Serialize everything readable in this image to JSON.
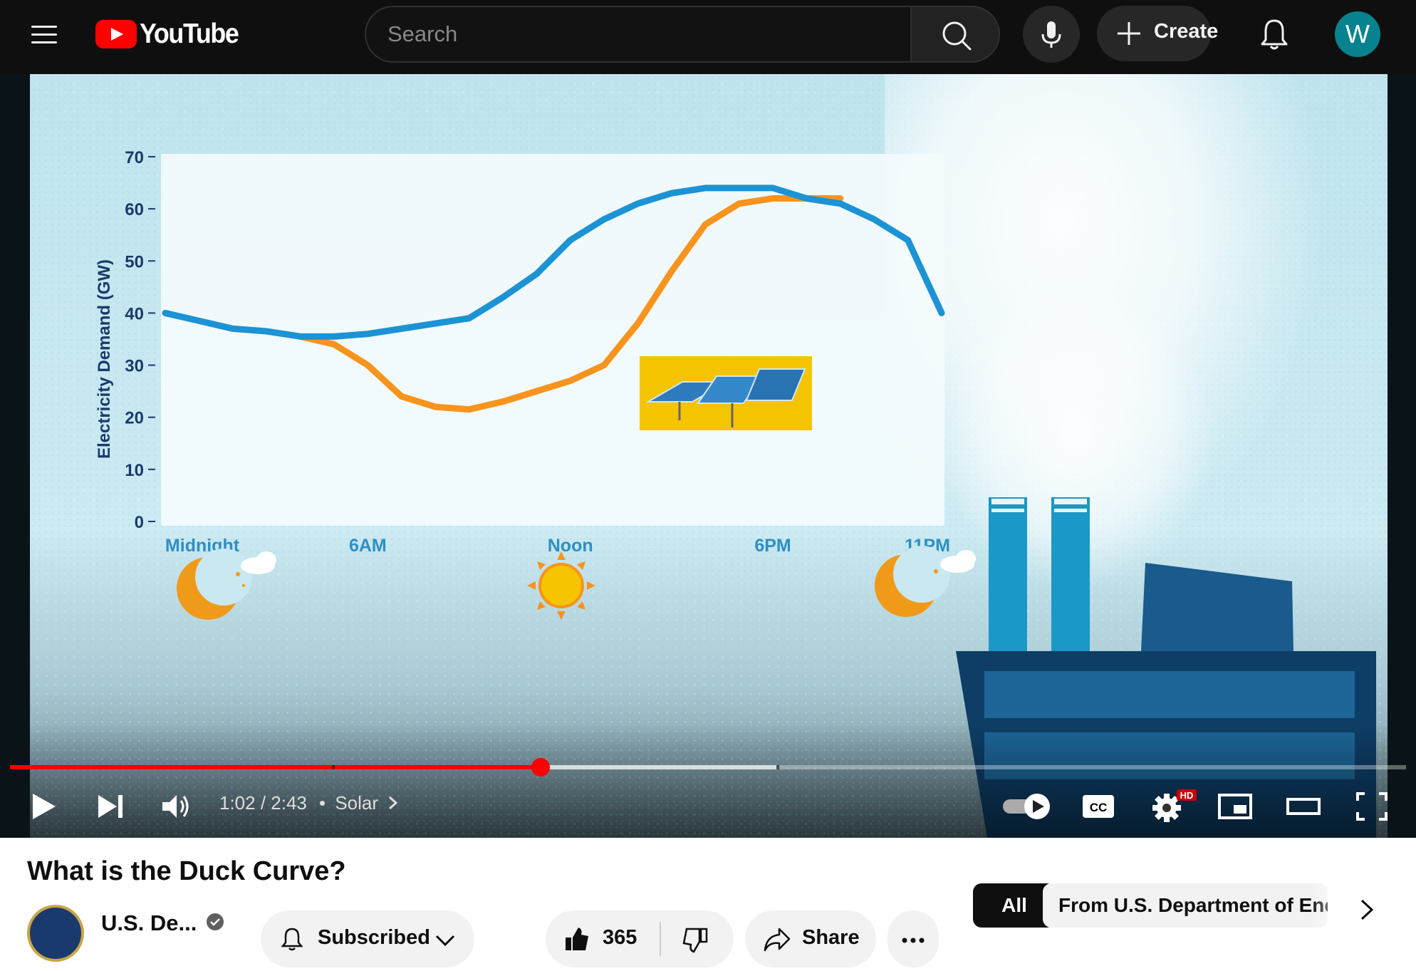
{
  "masthead": {
    "logo_text": "YouTube",
    "search_placeholder": "Search",
    "create_label": "Create",
    "avatar_initial": "W"
  },
  "player": {
    "time_current": "1:02",
    "time_separator": " / ",
    "time_total": "2:43",
    "chapter_separator": "•",
    "chapter_label": "Solar",
    "progress_played_fraction": 0.38,
    "progress_buffered_fraction": 0.55,
    "hd_badge": "HD",
    "cc_label": "CC"
  },
  "video_frame": {
    "chart_data": {
      "type": "line",
      "ylabel": "Electricity Demand (GW)",
      "yticks": [
        0,
        10,
        20,
        30,
        40,
        50,
        60,
        70
      ],
      "ylim": [
        0,
        70
      ],
      "x_tick_labels": [
        "Midnight",
        "6AM",
        "Noon",
        "6PM",
        "11PM"
      ],
      "x_tick_hours": [
        0,
        6,
        12,
        18,
        23
      ],
      "xlim": [
        0,
        23
      ],
      "series": [
        {
          "color": "#1b93d4",
          "x": [
            0,
            1,
            2,
            3,
            4,
            5,
            6,
            7,
            8,
            9,
            10,
            11,
            12,
            13,
            14,
            15,
            16,
            17,
            18,
            19,
            20,
            21,
            22,
            23
          ],
          "values": [
            40,
            38.5,
            37,
            36.5,
            35.5,
            35.5,
            36,
            37,
            38,
            39,
            43,
            47.5,
            54,
            58,
            61,
            63,
            64,
            64,
            64,
            62,
            61,
            58,
            54,
            40
          ]
        },
        {
          "color": "#f7941d",
          "x": [
            4,
            5,
            6,
            7,
            8,
            9,
            10,
            11,
            12,
            13,
            14,
            15,
            16,
            17,
            18,
            19,
            20
          ],
          "values": [
            35.5,
            34,
            30,
            24,
            22,
            21.5,
            23,
            25,
            27,
            30,
            38,
            48,
            57,
            61,
            62,
            62,
            62
          ]
        }
      ]
    },
    "icons": [
      "moon-icon",
      "cloud-icon",
      "sun-icon",
      "solar-panel-icon",
      "factory-icon"
    ]
  },
  "below": {
    "title": "What is the Duck Curve?",
    "channel_name": "U.S. De...",
    "subscribe_label": "Subscribed",
    "like_count": "365",
    "share_label": "Share",
    "chip_all": "All",
    "chip_from": "From U.S. Department of Ener"
  },
  "colors": {
    "brand_red": "#ff0000",
    "masthead_bg": "#0f0f0f",
    "demand_line": "#1b93d4",
    "net_load_line": "#f7941d",
    "avatar_bg": "#06838f"
  }
}
